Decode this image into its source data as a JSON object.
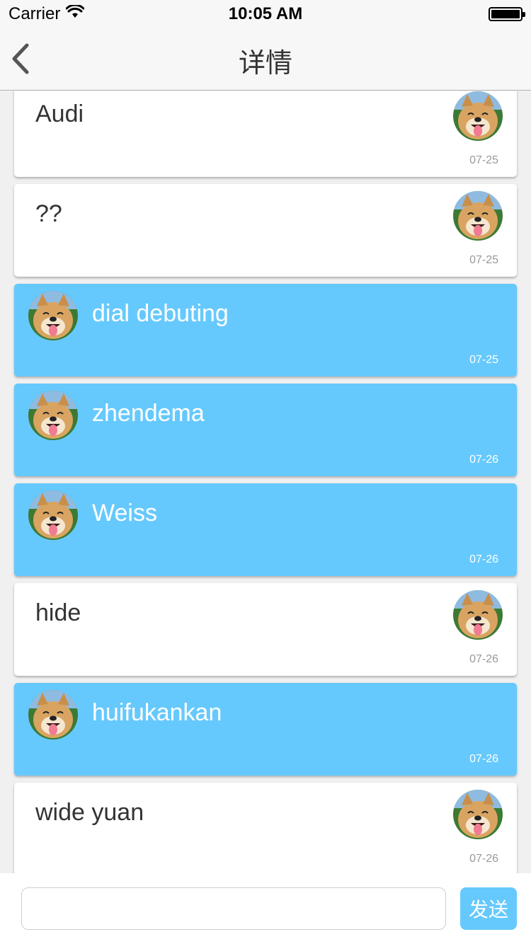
{
  "status_bar": {
    "carrier": "Carrier",
    "time": "10:05 AM"
  },
  "nav": {
    "title": "详情",
    "back_icon": "chevron-left-icon"
  },
  "messages": [
    {
      "text": "Audi",
      "date": "07-25",
      "side": "in"
    },
    {
      "text": "??",
      "date": "07-25",
      "side": "in"
    },
    {
      "text": "dial debuting",
      "date": "07-25",
      "side": "out"
    },
    {
      "text": "zhendema",
      "date": "07-26",
      "side": "out"
    },
    {
      "text": "Weiss",
      "date": "07-26",
      "side": "out"
    },
    {
      "text": "hide",
      "date": "07-26",
      "side": "in"
    },
    {
      "text": "huifukankan",
      "date": "07-26",
      "side": "out"
    },
    {
      "text": "wide yuan",
      "date": "07-26",
      "side": "in"
    }
  ],
  "input": {
    "value": "",
    "placeholder": "",
    "send_label": "发送"
  },
  "colors": {
    "accent": "#66c9fd",
    "incoming_bg": "#ffffff",
    "outgoing_bg": "#66c9fd",
    "page_bg": "#f0f0f0"
  }
}
